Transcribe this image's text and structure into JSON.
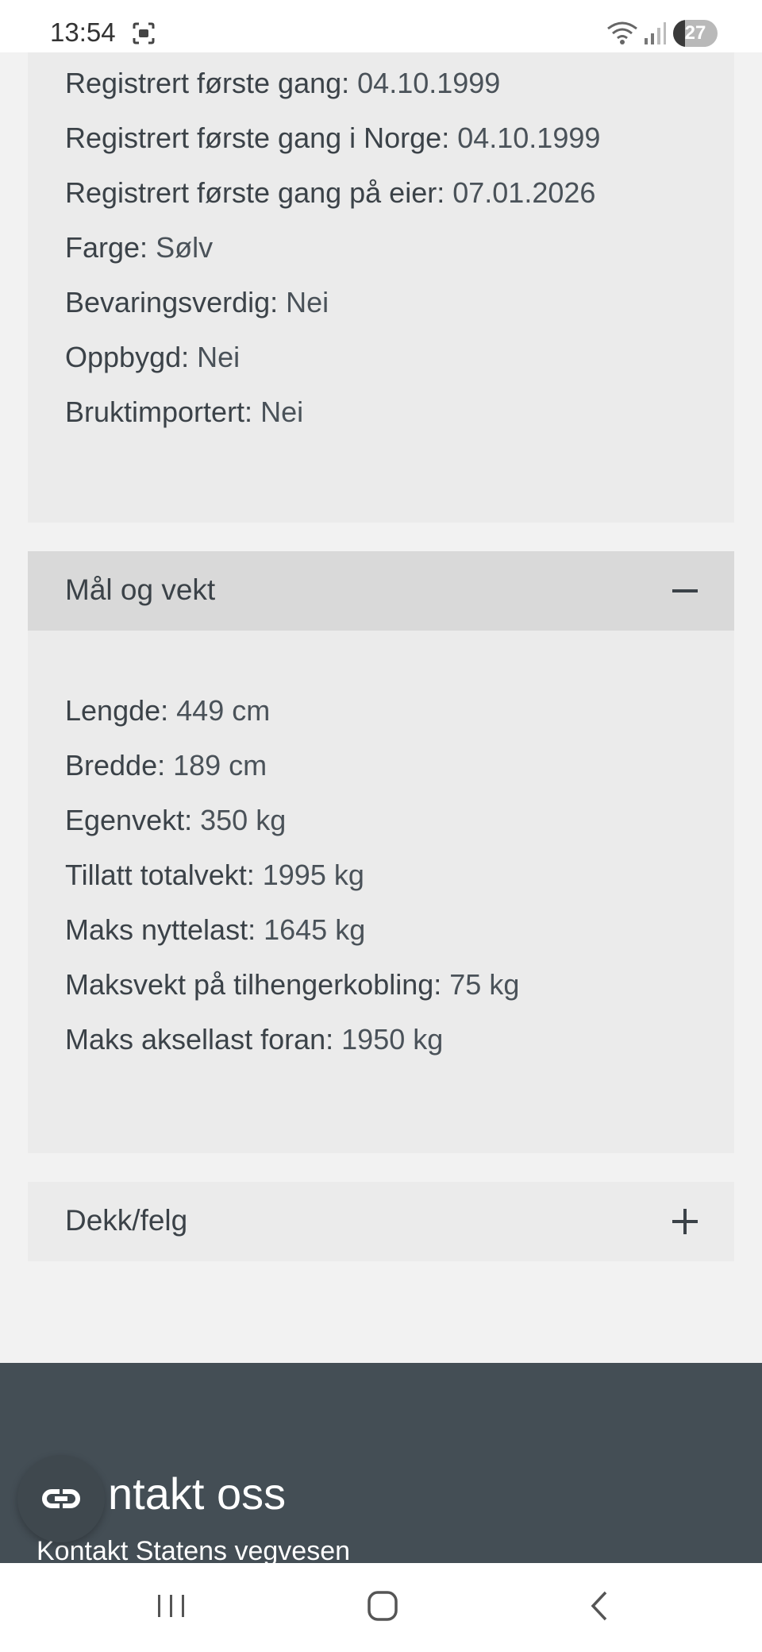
{
  "status_bar": {
    "time": "13:54",
    "battery": "27",
    "battery_level": 0.27
  },
  "vehicle_info": {
    "rows": [
      {
        "label": "Registrert første gang:",
        "value": "04.10.1999"
      },
      {
        "label": "Registrert første gang i Norge:",
        "value": "04.10.1999"
      },
      {
        "label": "Registrert første gang på eier:",
        "value": "07.01.2026"
      },
      {
        "label": "Farge:",
        "value": "Sølv"
      },
      {
        "label": "Bevaringsverdig:",
        "value": "Nei"
      },
      {
        "label": "Oppbygd:",
        "value": "Nei"
      },
      {
        "label": "Bruktimportert:",
        "value": "Nei"
      }
    ]
  },
  "dimensions": {
    "title": "Mål og vekt",
    "expanded": true,
    "rows": [
      {
        "label": "Lengde:",
        "value": "449 cm"
      },
      {
        "label": "Bredde:",
        "value": "189 cm"
      },
      {
        "label": "Egenvekt:",
        "value": "350 kg"
      },
      {
        "label": "Tillatt totalvekt:",
        "value": "1995 kg"
      },
      {
        "label": "Maks nyttelast:",
        "value": "1645 kg"
      },
      {
        "label": "Maksvekt på tilhengerkobling:",
        "value": "75 kg"
      },
      {
        "label": "Maks aksellast foran:",
        "value": "1950 kg"
      }
    ]
  },
  "tires": {
    "title": "Dekk/felg",
    "expanded": false
  },
  "footer": {
    "heading": "ntakt oss",
    "subtitle": "Kontakt Statens vegvesen"
  },
  "icons": {
    "collapse": "minus-icon",
    "expand": "plus-icon",
    "chat": "chat-link-icon",
    "nav_recent": "recent-apps-icon",
    "nav_home": "home-icon",
    "nav_back": "back-icon"
  },
  "colors": {
    "page_bg": "#f2f2f2",
    "card_bg": "#ebebeb",
    "header_open_bg": "#d9d9d9",
    "text": "#3b4248",
    "footer_bg": "#444e55"
  }
}
